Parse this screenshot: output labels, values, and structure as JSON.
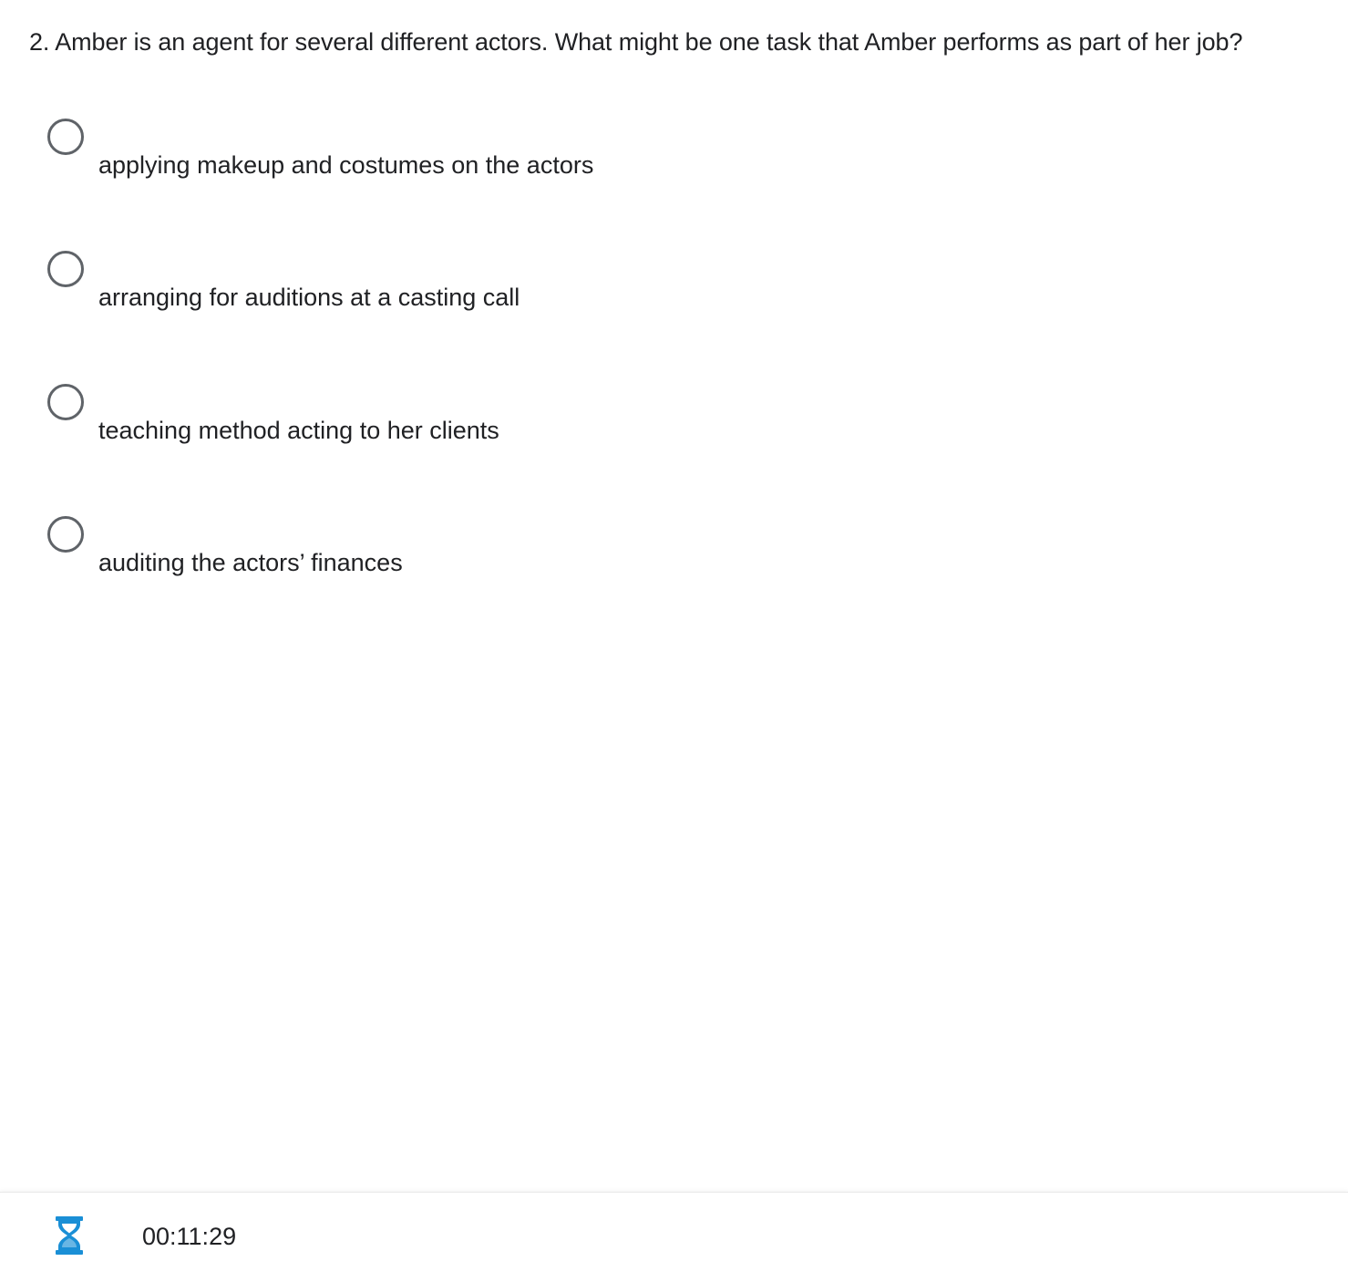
{
  "question": {
    "text": "2. Amber is an agent for several different actors. What might be one task that Amber performs as part of her job?"
  },
  "options": [
    {
      "label": "applying makeup and costumes on the actors",
      "selected": false
    },
    {
      "label": "arranging for auditions at a casting call",
      "selected": false
    },
    {
      "label": "teaching method acting to her clients",
      "selected": false
    },
    {
      "label": "auditing the actors’ finances",
      "selected": false
    }
  ],
  "footer": {
    "timer_icon": "hourglass-icon",
    "timer_value": "00:11:29",
    "accent_color": "#1a8fd6"
  },
  "colors": {
    "text": "#202124",
    "radio_border": "#5f6368"
  }
}
